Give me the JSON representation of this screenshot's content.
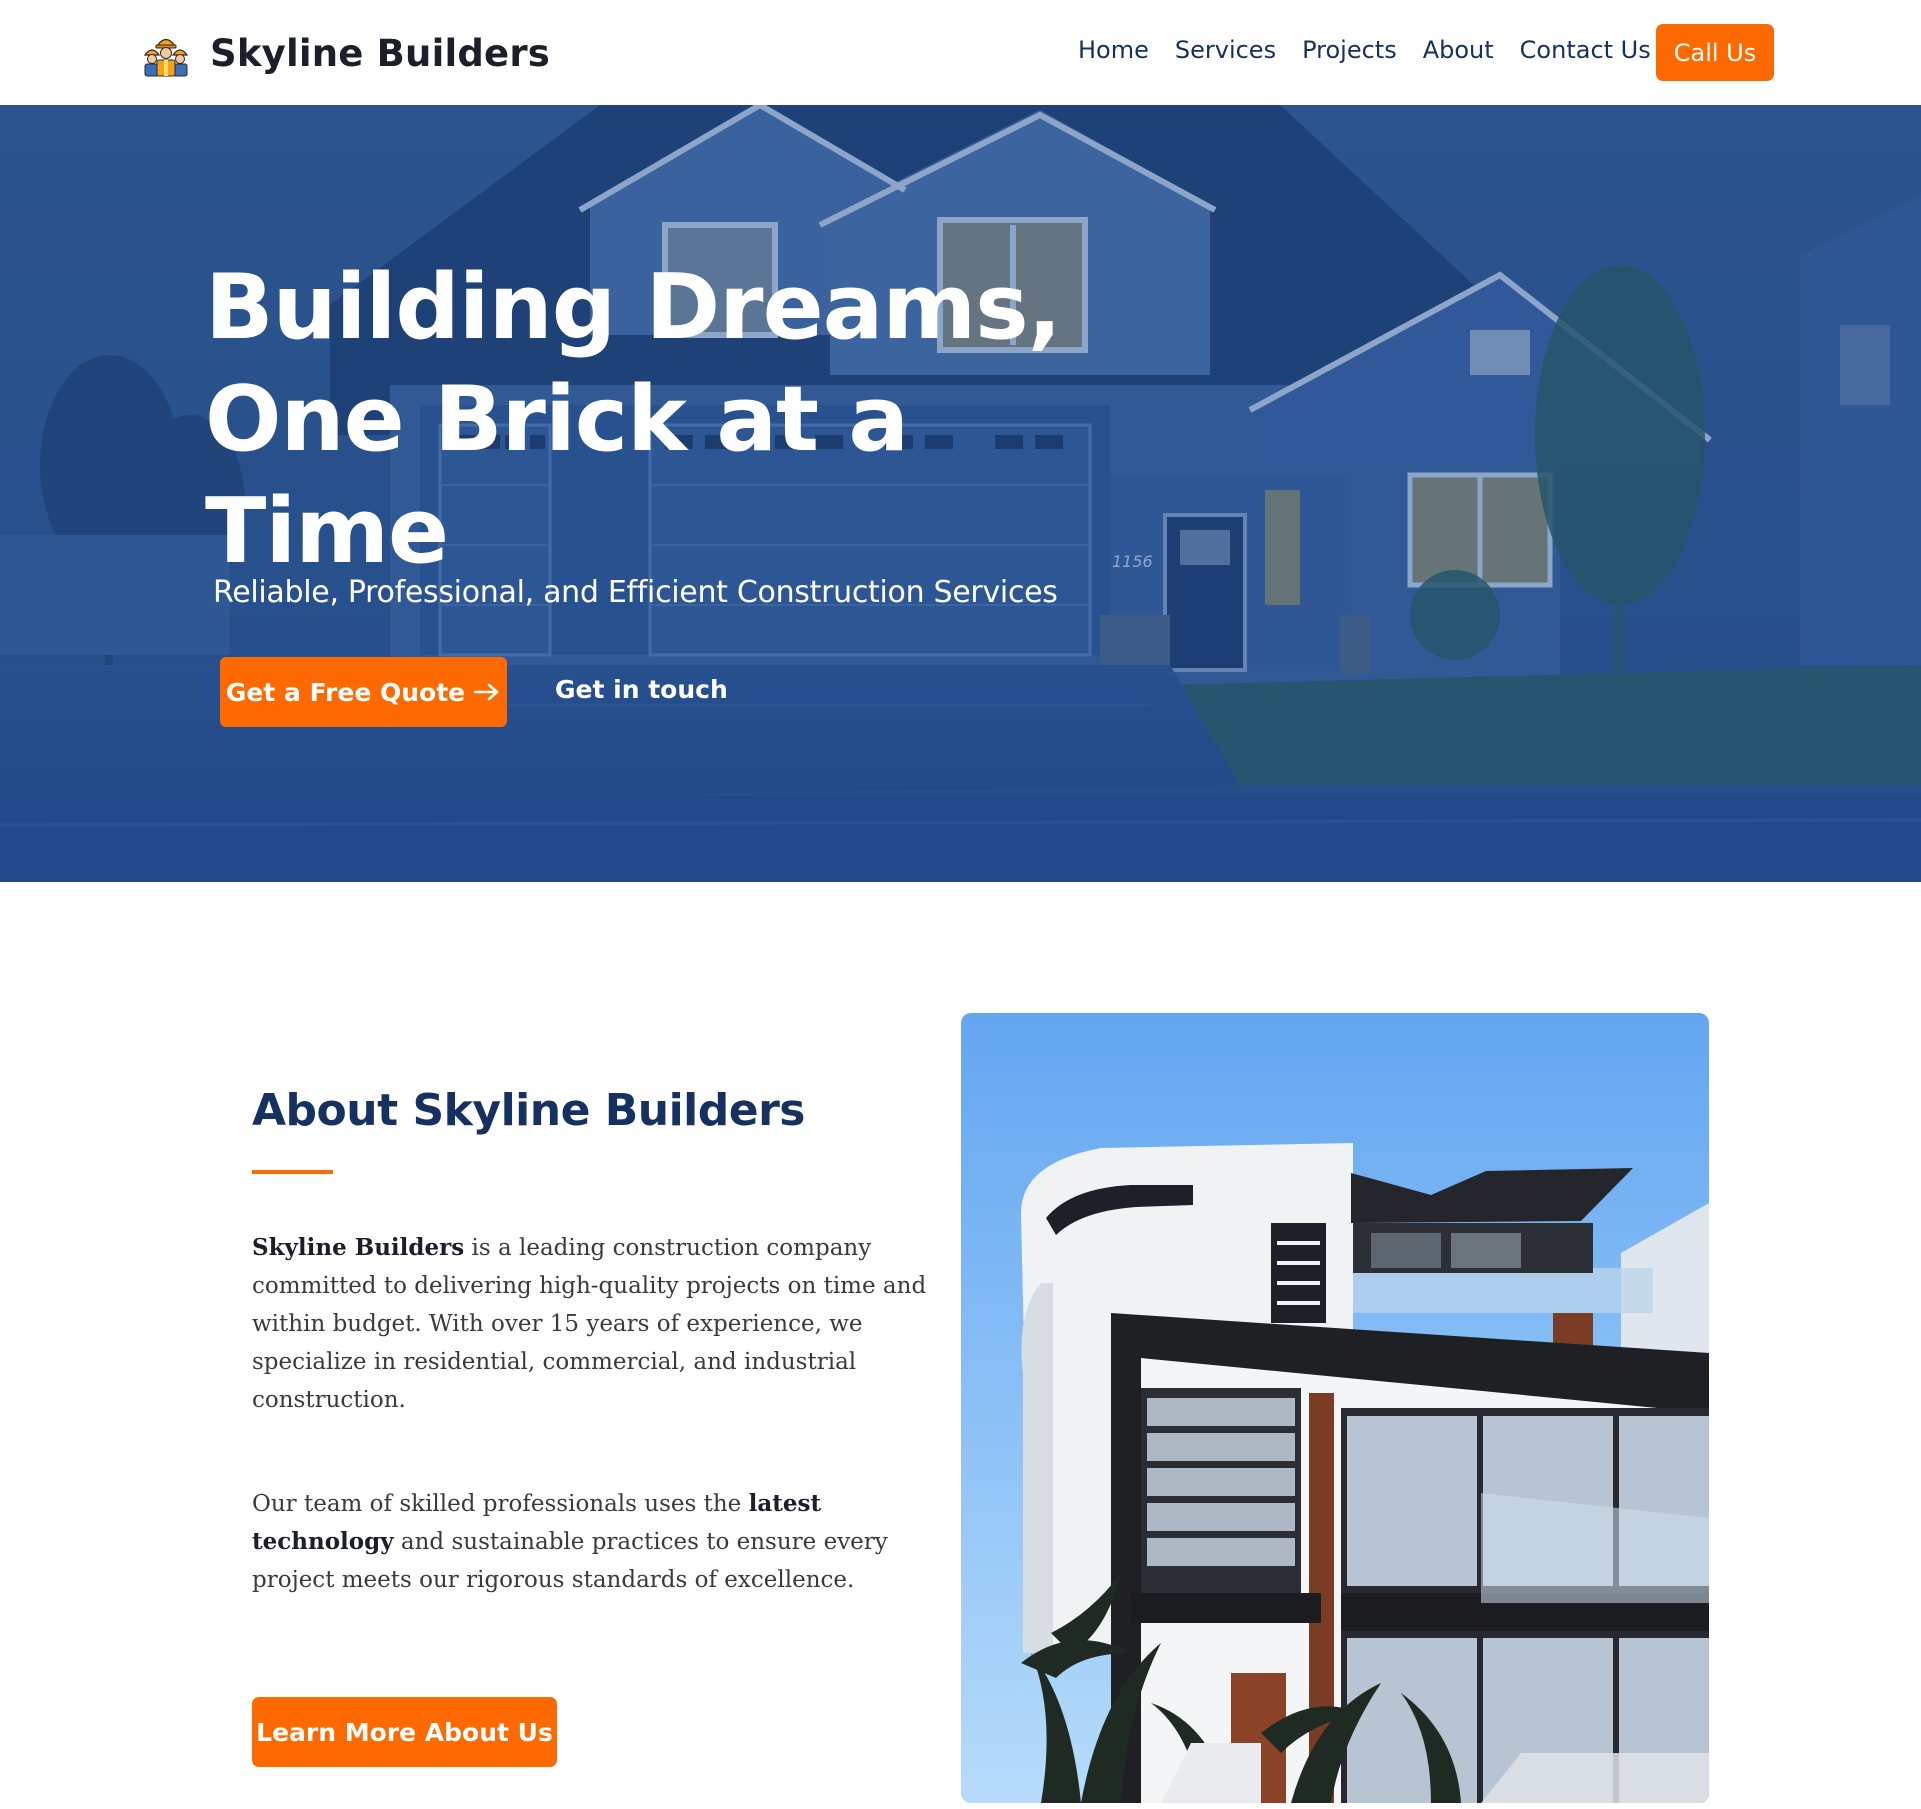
{
  "header": {
    "brand_name": "Skyline Builders",
    "logo_icon": "construction-workers-icon",
    "nav": [
      "Home",
      "Services",
      "Projects",
      "About",
      "Contact Us"
    ],
    "call_label": "Call Us"
  },
  "hero": {
    "title": "Building Dreams, One Brick at a Time",
    "subtitle": "Reliable, Professional, and Efficient Construction Services",
    "quote_label": "Get a Free Quote",
    "quote_icon": "arrow-right-icon",
    "touch_label": "Get in touch",
    "house_number": "1156"
  },
  "about": {
    "title": "About Skyline Builders",
    "p1_strong": "Skyline Builders",
    "p1_rest": " is a leading construction company committed to delivering high-quality projects on time and within budget. With over 15 years of experience, we specialize in residential, commercial, and industrial construction.",
    "p2_a": "Our team of skilled professionals uses the ",
    "p2_strong": "latest technology",
    "p2_b": " and sustainable practices to ensure every project meets our rigorous standards of excellence.",
    "button_label": "Learn More About Us"
  },
  "colors": {
    "accent": "#ff6a00",
    "navy": "#16305f",
    "hero_overlay": "#1e4a8c"
  }
}
